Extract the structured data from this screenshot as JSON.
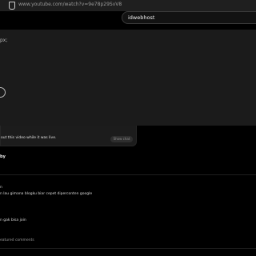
{
  "browser": {
    "url": "www.youtube.com/watch?v=9e78p29SvV8"
  },
  "header": {
    "search_value": "idwebhost"
  },
  "player": {
    "cut_text": "px;"
  },
  "chat": {
    "message": "out this video while it was live.",
    "button_label": "Show chat"
  },
  "comments": {
    "sort_label": "by",
    "items": [
      {
        "line1": "n",
        "line2": "n lau gimana blogku biar cepet diperconten google"
      },
      {
        "line1": "n gak bisa join"
      }
    ],
    "featured_label": "eatured comments"
  },
  "colors": {
    "background": "#000000",
    "player_bg": "#1b1b1b",
    "chat_bg": "#1c1c1c"
  }
}
